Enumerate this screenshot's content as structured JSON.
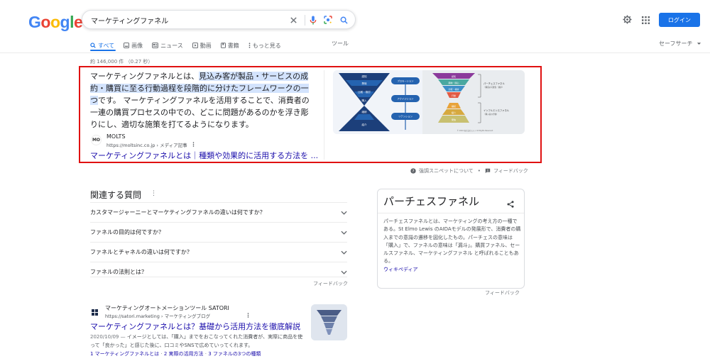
{
  "logo": {
    "letters": [
      "G",
      "o",
      "o",
      "g",
      "l",
      "e"
    ],
    "colors": [
      "#4285f4",
      "#ea4335",
      "#fbbc05",
      "#4285f4",
      "#34a853",
      "#ea4335"
    ]
  },
  "search": {
    "query": "マーケティングファネル"
  },
  "header": {
    "login": "ログイン"
  },
  "tabs": [
    {
      "label": "すべて",
      "icon": "search-icon"
    },
    {
      "label": "画像",
      "icon": "image-icon"
    },
    {
      "label": "ニュース",
      "icon": "news-icon"
    },
    {
      "label": "動画",
      "icon": "video-icon"
    },
    {
      "label": "書籍",
      "icon": "book-icon"
    },
    {
      "label": "もっと見る",
      "icon": "more-vert-icon"
    }
  ],
  "tools": "ツール",
  "safesearch": "セーフサーチ",
  "stats": "約 146,000 件 （0.27 秒）",
  "snippet": {
    "text_pre": "マーケティングファネルとは、",
    "text_hl": "見込み客が製品・サービスの成約・購買に至る行動過程を段階的に分けたフレームワークの一つ",
    "text_post": "です。 マーケティングファネルを活用することで、消費者の一連の購買プロセスの中での、どこに問題があるのかを浮き彫りにし、適切な施策を打てるようになります。",
    "source_logo": "MO",
    "source_name": "MOLTS",
    "source_url": "https://moltsinc.co.jp › メディア記事",
    "title": "マーケティングファネルとは｜種類や効果的に活用する方法を ...",
    "image": {
      "funnel_labels": [
        "認知",
        "興味",
        "比較・検討",
        "購入",
        "継続",
        "紹介"
      ],
      "flow_labels": [
        "プロモーション",
        "アクイジション",
        "リテンション"
      ],
      "right_labels": [
        "認知",
        "興味・関心",
        "比較・検討",
        "行動",
        "継続",
        "紹介",
        "発信"
      ],
      "side_labels": [
        "パーチェスファネル",
        "（購買の可能性・順序）",
        "インフルエンスファネル",
        "（購入者の行動）"
      ],
      "footer": "© 2022 株式会社モルツ All Rights Reserved"
    }
  },
  "feedback_row": {
    "about": "強調スニペットについて",
    "dot": "•",
    "feedback": "フィードバック"
  },
  "paa": {
    "title": "関連する質問",
    "items": [
      "カスタマージャーニーとマーケティングファネルの違いは何ですか？",
      "ファネルの目的は何ですか？",
      "ファネルとチャネルの違いは何ですか？",
      "ファネルの法則とは？"
    ],
    "feedback": "フィードバック"
  },
  "knowledge": {
    "title": "パーチェスファネル",
    "text": "パーチェスファネルとは、マーケティングの考え方の一種である。St Elmo Lewis のAIDAモデルの発展形で、消費者の購入までの意識の遷移を図化したもの。パーチェスの意味は「購入」で、ファネルの意味は「漏斗」。購買ファネル、セールスファネル、マーケティングファネル と呼ばれることもある。",
    "link": "ウィキペディア",
    "feedback": "フィードバック"
  },
  "result2": {
    "name": "マーケティングオートメーションツール SATORI",
    "url": "https://satori.marketing › マーケティングブログ",
    "title": "マーケティングファネルとは？基礎から活用方法を徹底解説",
    "date": "2020/10/09 — ",
    "desc": "イメージとしては、「購入」までをおこなってくれた消費者が、実際に商品を使って「良かった」と感じた後に、口コミやSNSで広めていってくれます。",
    "links": [
      "1 マーケティングファネルとは",
      "2 実際の活用方法",
      "3 ファネルの3つの種類"
    ],
    "link_sep": " · "
  },
  "colors": {
    "accent": "#1a73e8",
    "link": "#1a0dab",
    "highlight_border": "#e01111",
    "funnel_dark": "#1c3f7a",
    "funnel_mid": "#2563b0"
  }
}
